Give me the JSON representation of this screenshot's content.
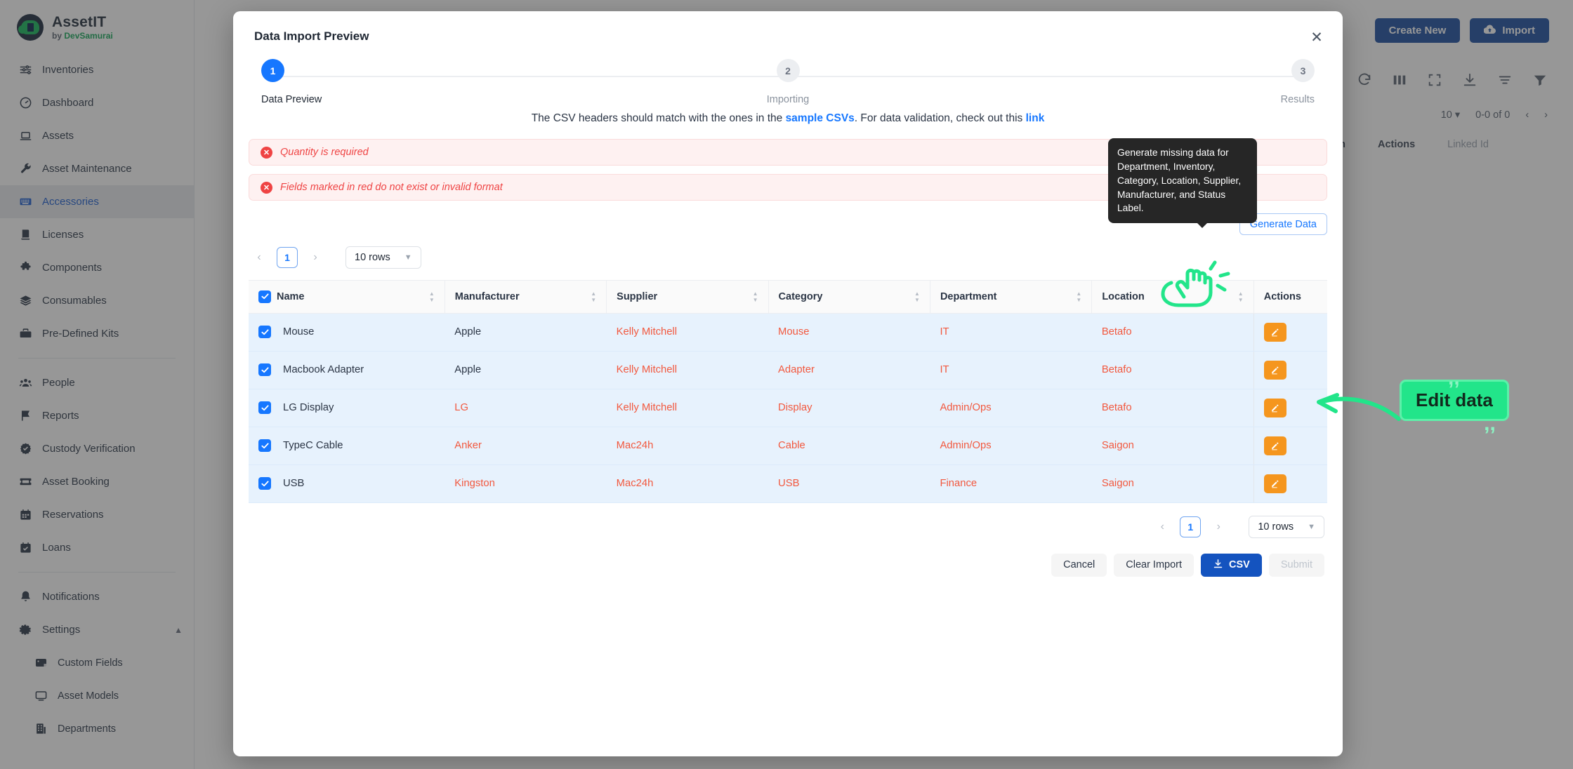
{
  "sidebar": {
    "brand": {
      "title": "AssetIT",
      "by": "by",
      "company": "DevSamurai"
    },
    "items": [
      {
        "label": "Inventories",
        "icon": "sliders-icon"
      },
      {
        "label": "Dashboard",
        "icon": "gauge-icon"
      },
      {
        "label": "Assets",
        "icon": "laptop-icon"
      },
      {
        "label": "Asset Maintenance",
        "icon": "wrench-icon"
      },
      {
        "label": "Accessories",
        "icon": "keyboard-icon",
        "active": true
      },
      {
        "label": "Licenses",
        "icon": "license-icon"
      },
      {
        "label": "Components",
        "icon": "puzzle-icon"
      },
      {
        "label": "Consumables",
        "icon": "layers-icon"
      },
      {
        "label": "Pre-Defined Kits",
        "icon": "toolbox-icon"
      }
    ],
    "items2": [
      {
        "label": "People",
        "icon": "people-icon"
      },
      {
        "label": "Reports",
        "icon": "flag-icon"
      },
      {
        "label": "Custody Verification",
        "icon": "badge-check-icon"
      },
      {
        "label": "Asset Booking",
        "icon": "ticket-icon"
      },
      {
        "label": "Reservations",
        "icon": "calendar-icon"
      },
      {
        "label": "Loans",
        "icon": "calendar-check-icon"
      }
    ],
    "items3": [
      {
        "label": "Notifications",
        "icon": "bell-icon"
      },
      {
        "label": "Settings",
        "icon": "gear-icon",
        "caret": "⌃"
      }
    ],
    "settings_children": [
      {
        "label": "Custom Fields",
        "icon": "tag-icon"
      },
      {
        "label": "Asset Models",
        "icon": "monitor-icon"
      },
      {
        "label": "Departments",
        "icon": "building-icon"
      }
    ]
  },
  "background": {
    "create_new": "Create New",
    "import": "Import",
    "rows_per_page": "10",
    "range": "0-0 of 0",
    "col_inven": "Inven",
    "col_actions": "Actions",
    "col_linked": "Linked Id"
  },
  "modal": {
    "title": "Data Import Preview",
    "close": "✕",
    "steps": [
      {
        "num": "1",
        "label": "Data Preview",
        "state": "done"
      },
      {
        "num": "2",
        "label": "Importing",
        "state": "todo"
      },
      {
        "num": "3",
        "label": "Results",
        "state": "todo"
      }
    ],
    "hint": {
      "part1": "The CSV headers should match with the ones in the ",
      "link1": "sample CSVs",
      "part2": ". For data validation, check out this ",
      "link2": "link"
    },
    "alerts": [
      {
        "icon": "error-icon",
        "text": "Quantity is required"
      },
      {
        "icon": "error-icon",
        "text": "Fields marked in red do not exist or invalid format"
      }
    ],
    "tooltip": "Generate missing data for Department, Inventory, Category, Location, Supplier, Manufacturer, and Status Label.",
    "generate_button": "Generate Data",
    "pager": {
      "prev": "‹",
      "page": "1",
      "next": "›",
      "rows": "10 rows"
    },
    "table": {
      "columns": [
        "Name",
        "Manufacturer",
        "Supplier",
        "Category",
        "Department",
        "Location",
        "Actions"
      ],
      "rows": [
        {
          "checked": true,
          "name": "Mouse",
          "manufacturer": "Apple",
          "supplier": "Kelly Mitchell",
          "category": "Mouse",
          "department": "IT",
          "location": "Betafo",
          "bad": [
            "supplier",
            "category",
            "department",
            "location"
          ]
        },
        {
          "checked": true,
          "name": "Macbook Adapter",
          "manufacturer": "Apple",
          "supplier": "Kelly Mitchell",
          "category": "Adapter",
          "department": "IT",
          "location": "Betafo",
          "bad": [
            "supplier",
            "category",
            "department",
            "location"
          ]
        },
        {
          "checked": true,
          "name": "LG Display",
          "manufacturer": "LG",
          "supplier": "Kelly Mitchell",
          "category": "Display",
          "department": "Admin/Ops",
          "location": "Betafo",
          "bad": [
            "manufacturer",
            "supplier",
            "category",
            "department",
            "location"
          ]
        },
        {
          "checked": true,
          "name": "TypeC Cable",
          "manufacturer": "Anker",
          "supplier": "Mac24h",
          "category": "Cable",
          "department": "Admin/Ops",
          "location": "Saigon",
          "bad": [
            "manufacturer",
            "supplier",
            "category",
            "department",
            "location"
          ]
        },
        {
          "checked": true,
          "name": "USB",
          "manufacturer": "Kingston",
          "supplier": "Mac24h",
          "category": "USB",
          "department": "Finance",
          "location": "Saigon",
          "bad": [
            "manufacturer",
            "supplier",
            "category",
            "department",
            "location"
          ]
        }
      ]
    },
    "footer": {
      "cancel": "Cancel",
      "clear_import": "Clear Import",
      "csv": "CSV",
      "submit": "Submit"
    }
  },
  "annotations": {
    "callout": "Edit data"
  },
  "colors": {
    "accent": "#1677ff",
    "primary": "#1453bf",
    "error": "#ef4444",
    "invalid_text": "#f2583e",
    "row_bg": "#e7f2fd",
    "edit_btn": "#f5961e",
    "annotation_green": "#22e58a"
  }
}
